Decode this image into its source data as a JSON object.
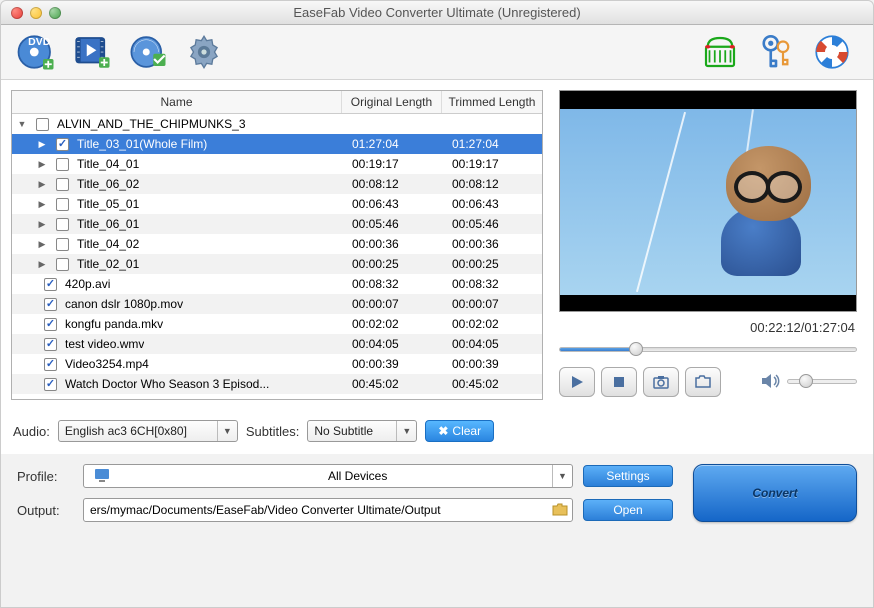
{
  "window": {
    "title": "EaseFab Video Converter Ultimate (Unregistered)"
  },
  "toolbar": {
    "add_dvd": "Add DVD",
    "add_video": "Add Video",
    "add_bluray": "Add Blu-ray",
    "settings": "Settings",
    "shop": "Shop",
    "register": "Register",
    "help": "Help"
  },
  "table": {
    "headers": {
      "name": "Name",
      "original_length": "Original Length",
      "trimmed_length": "Trimmed Length"
    },
    "rows": [
      {
        "type": "parent",
        "checked": false,
        "name": "ALVIN_AND_THE_CHIPMUNKS_3",
        "orig": "",
        "trim": "",
        "expanded": true
      },
      {
        "type": "child",
        "checked": true,
        "selected": true,
        "name": "Title_03_01(Whole Film)",
        "orig": "01:27:04",
        "trim": "01:27:04"
      },
      {
        "type": "child",
        "checked": false,
        "name": "Title_04_01",
        "orig": "00:19:17",
        "trim": "00:19:17"
      },
      {
        "type": "child",
        "checked": false,
        "name": "Title_06_02",
        "orig": "00:08:12",
        "trim": "00:08:12"
      },
      {
        "type": "child",
        "checked": false,
        "name": "Title_05_01",
        "orig": "00:06:43",
        "trim": "00:06:43"
      },
      {
        "type": "child",
        "checked": false,
        "name": "Title_06_01",
        "orig": "00:05:46",
        "trim": "00:05:46"
      },
      {
        "type": "child",
        "checked": false,
        "name": "Title_04_02",
        "orig": "00:00:36",
        "trim": "00:00:36"
      },
      {
        "type": "child",
        "checked": false,
        "name": "Title_02_01",
        "orig": "00:00:25",
        "trim": "00:00:25"
      },
      {
        "type": "file",
        "checked": true,
        "name": "420p.avi",
        "orig": "00:08:32",
        "trim": "00:08:32"
      },
      {
        "type": "file",
        "checked": true,
        "name": "canon dslr 1080p.mov",
        "orig": "00:00:07",
        "trim": "00:00:07"
      },
      {
        "type": "file",
        "checked": true,
        "name": "kongfu panda.mkv",
        "orig": "00:02:02",
        "trim": "00:02:02"
      },
      {
        "type": "file",
        "checked": true,
        "name": "test video.wmv",
        "orig": "00:04:05",
        "trim": "00:04:05"
      },
      {
        "type": "file",
        "checked": true,
        "name": "Video3254.mp4",
        "orig": "00:00:39",
        "trim": "00:00:39"
      },
      {
        "type": "file",
        "checked": true,
        "name": "Watch Doctor Who Season 3 Episod...",
        "orig": "00:45:02",
        "trim": "00:45:02"
      }
    ]
  },
  "audio": {
    "label": "Audio:",
    "value": "English ac3 6CH[0x80]"
  },
  "subtitles": {
    "label": "Subtitles:",
    "value": "No Subtitle"
  },
  "clear_label": "Clear",
  "preview": {
    "time": "00:22:12/01:27:04"
  },
  "profile": {
    "label": "Profile:",
    "value": "All Devices",
    "settings_btn": "Settings"
  },
  "output": {
    "label": "Output:",
    "value": "ers/mymac/Documents/EaseFab/Video Converter Ultimate/Output",
    "open_btn": "Open"
  },
  "convert_label": "Convert"
}
